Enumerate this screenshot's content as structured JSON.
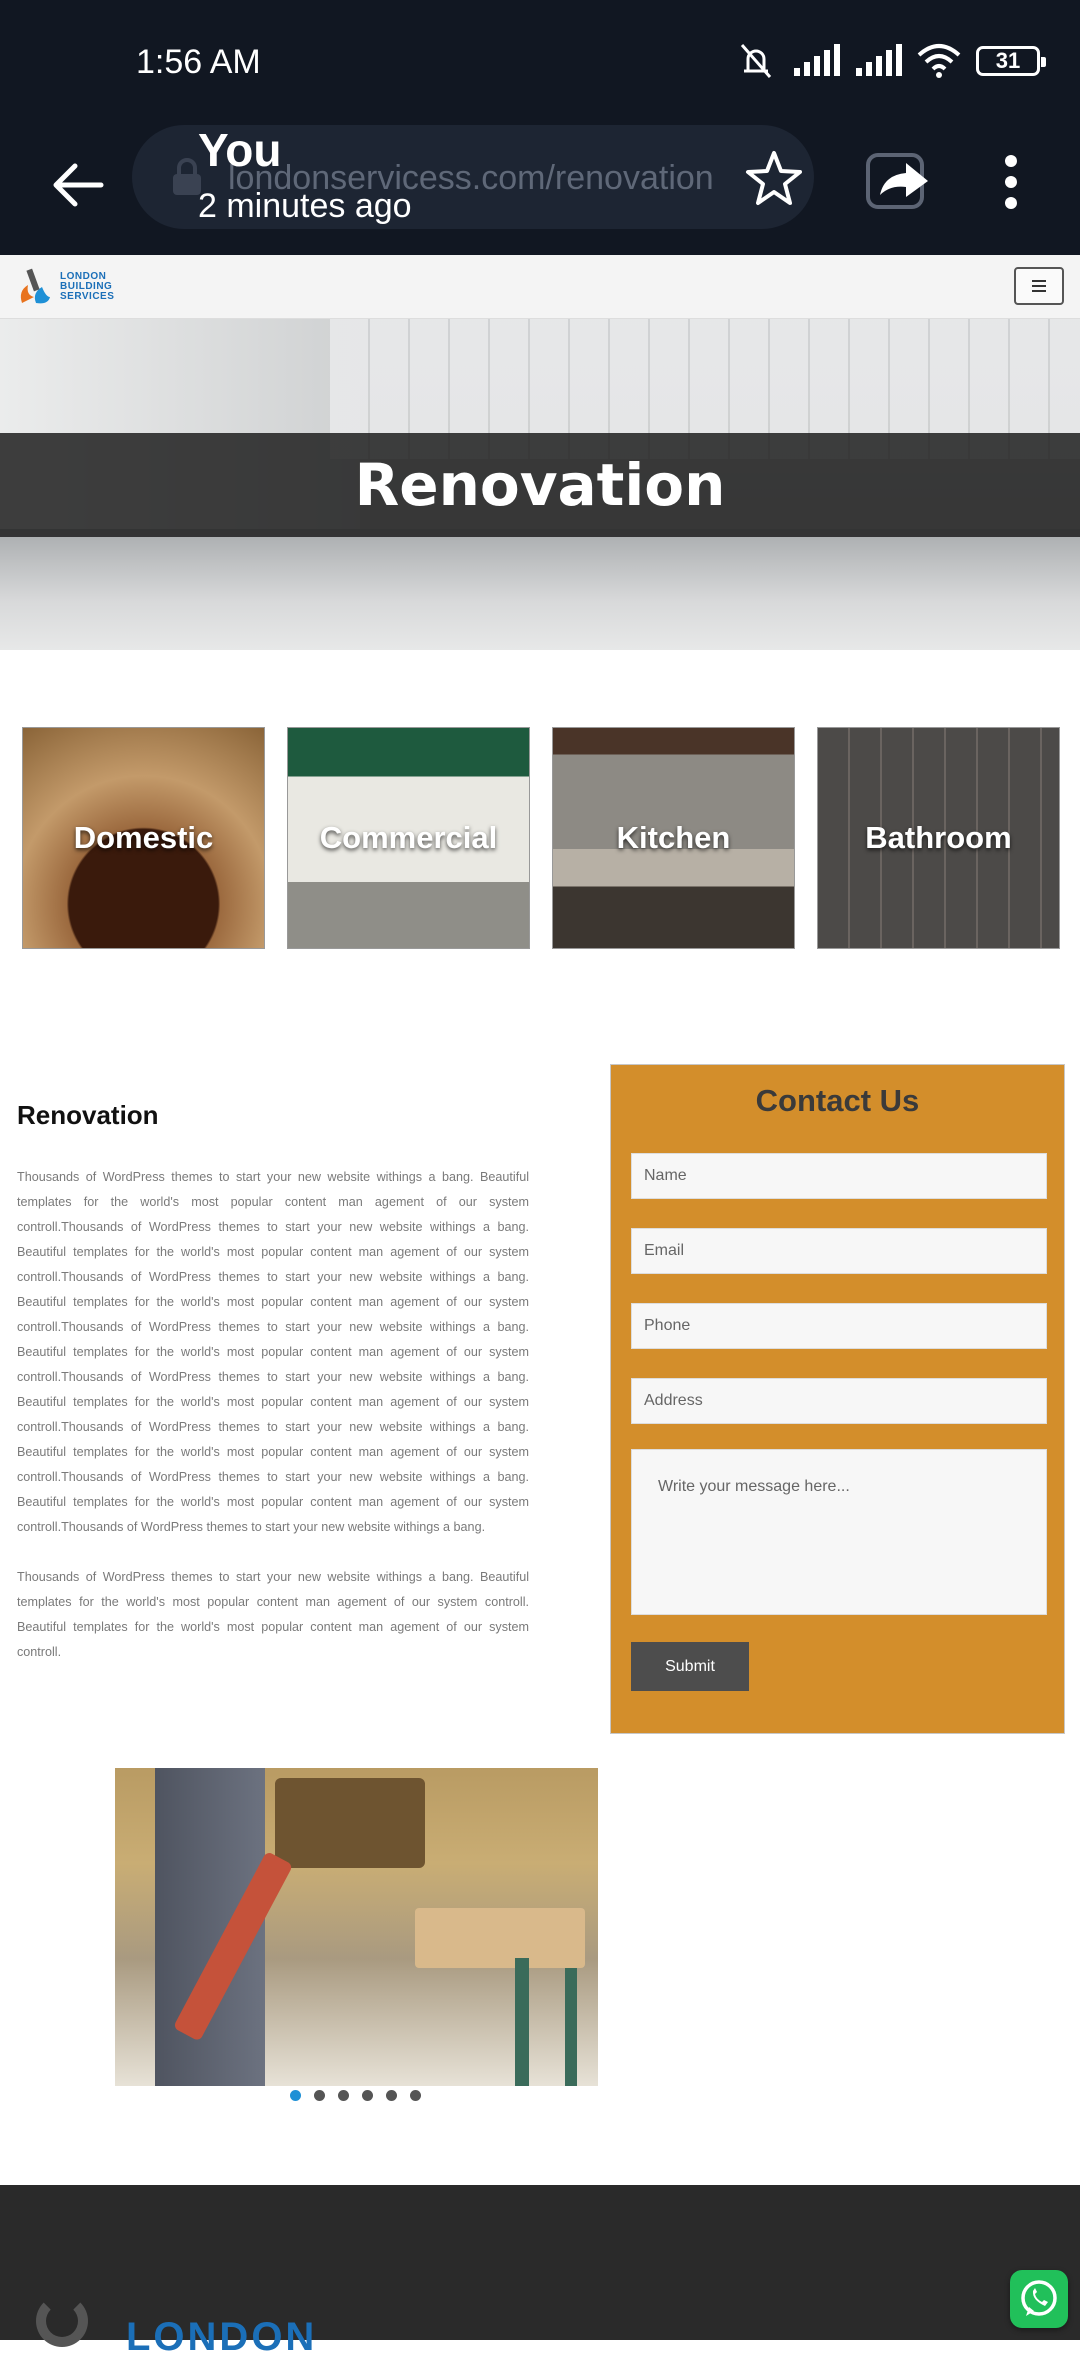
{
  "status_bar": {
    "time": "1:56 AM",
    "battery": "31"
  },
  "browser": {
    "url": "londonservicess.com/renovation",
    "overlay_title": "You",
    "overlay_subtitle": "2 minutes ago"
  },
  "site": {
    "logo_lines": [
      "LONDON",
      "BUILDING",
      "SERVICES"
    ],
    "hero_title": "Renovation",
    "categories": [
      "Domestic",
      "Commercial",
      "Kitchen",
      "Bathroom"
    ],
    "content_title": "Renovation",
    "paragraph1": "Thousands of WordPress themes to start your new website withings a bang. Beautiful templates for the world's most popular content man agement of our system controll.Thousands of WordPress themes to start your new website withings a bang. Beautiful templates for the world's most popular content man agement of our system controll.Thousands of WordPress themes to start your new website withings a bang. Beautiful templates for the world's most popular content man agement of our system controll.Thousands of WordPress themes to start your new website withings a bang. Beautiful templates for the world's most popular content man agement of our system controll.Thousands of WordPress themes to start your new website withings a bang. Beautiful templates for the world's most popular content man agement of our system controll.Thousands of WordPress themes to start your new website withings a bang. Beautiful templates for the world's most popular content man agement of our system controll.Thousands of WordPress themes to start your new website withings a bang. Beautiful templates for the world's most popular content man agement of our system controll.Thousands of WordPress themes to start your new website withings a bang.",
    "paragraph2": "Thousands of WordPress themes to start your new website withings a bang. Beautiful templates for the world's most popular content man agement of our system controll. Beautiful templates for the world's most popular content man agement of our system controll.",
    "contact": {
      "title": "Contact Us",
      "name_placeholder": "Name",
      "email_placeholder": "Email",
      "phone_placeholder": "Phone",
      "address_placeholder": "Address",
      "message_placeholder": "Write your message here...",
      "submit_label": "Submit"
    },
    "slider_dot_count": 6,
    "slider_active_index": 0,
    "footer_logo_text": "LONDON"
  },
  "colors": {
    "accent_orange": "#d38e2b",
    "brand_blue": "#1b6fb8",
    "status_bar_bg": "#111722"
  }
}
